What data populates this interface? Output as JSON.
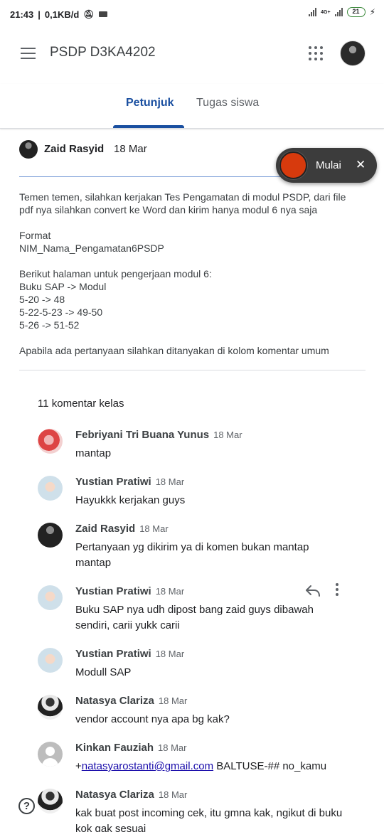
{
  "status_bar": {
    "time": "21:43",
    "speed": "0,1KB/d",
    "network": "4G+",
    "battery": "21"
  },
  "app_bar": {
    "title": "PSDP D3KA4202"
  },
  "tabs": [
    {
      "label": "Petunjuk",
      "active": true
    },
    {
      "label": "Tugas siswa",
      "active": false
    }
  ],
  "post": {
    "author": "Zaid Rasyid",
    "date": "18 Mar",
    "body": {
      "p1": "Temen temen, silahkan kerjakan Tes Pengamatan di modul PSDP, dari file pdf nya silahkan convert ke Word dan kirim hanya modul 6 nya saja",
      "format_label": "Format",
      "format_value": "NIM_Nama_Pengamatan6PSDP",
      "pages_intro": "Berikut halaman untuk pengerjaan modul 6:",
      "pages_1": "Buku SAP -> Modul",
      "pages_2": "5-20 -> 48",
      "pages_3": "5-22-5-23 -> 49-50",
      "pages_4": "5-26 -> 51-52",
      "closing": "Apabila ada pertanyaan silahkan ditanyakan di kolom komentar umum"
    }
  },
  "record_widget": {
    "label": "Mulai",
    "close": "✕"
  },
  "comments": {
    "title": "11 komentar kelas",
    "items": [
      {
        "name": "Febriyani Tri Buana Yunus",
        "date": "18 Mar",
        "text": "mantap"
      },
      {
        "name": "Yustian Pratiwi",
        "date": "18 Mar",
        "text": "Hayukkk kerjakan guys"
      },
      {
        "name": "Zaid Rasyid",
        "date": "18 Mar",
        "text": "Pertanyaan yg dikirim ya di komen bukan mantap mantap"
      },
      {
        "name": "Yustian Pratiwi",
        "date": "18 Mar",
        "text": "Buku SAP nya udh dipost bang zaid guys dibawah sendiri, carii yukk carii"
      },
      {
        "name": "Yustian Pratiwi",
        "date": "18 Mar",
        "text": "Modull SAP"
      },
      {
        "name": "Natasya Clariza",
        "date": "18 Mar",
        "text": "vendor account nya apa bg kak?"
      },
      {
        "name": "Kinkan Fauziah",
        "date": "18 Mar",
        "text_prefix": "+",
        "link": "natasyarostanti@gmail.com",
        "text_suffix": " BALTUSE-## no_kamu"
      },
      {
        "name": "Natasya Clariza",
        "date": "18 Mar",
        "text": "kak buat post incoming cek, itu gmna kak, ngikut di buku kok gak sesuai"
      }
    ]
  },
  "icons": {
    "menu": "menu-icon",
    "apps": "apps-grid-icon",
    "reply": "reply-icon",
    "more": "more-vert-icon",
    "help": "help-icon"
  },
  "colors": {
    "accent": "#1a4fa0",
    "record_button": "#d73a0d",
    "link": "#1a0dab"
  }
}
